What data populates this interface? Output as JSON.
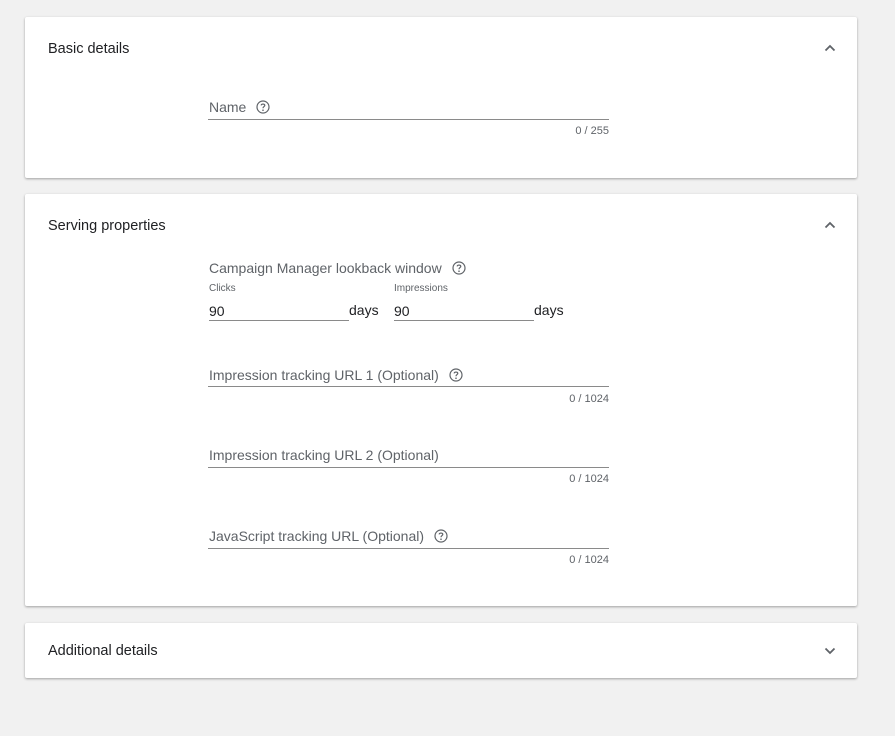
{
  "sections": {
    "basic": {
      "title": "Basic details",
      "name_field": {
        "label": "Name",
        "value": "",
        "counter": "0 / 255"
      }
    },
    "serving": {
      "title": "Serving properties",
      "lookback": {
        "title": "Campaign Manager lookback window",
        "clicks_label": "Clicks",
        "clicks_value": "90",
        "impressions_label": "Impressions",
        "impressions_value": "90",
        "unit": "days"
      },
      "impression_url_1": {
        "label": "Impression tracking URL 1 (Optional)",
        "value": "",
        "counter": "0 / 1024"
      },
      "impression_url_2": {
        "label": "Impression tracking URL 2 (Optional)",
        "value": "",
        "counter": "0 / 1024"
      },
      "javascript_url": {
        "label": "JavaScript tracking URL (Optional)",
        "value": "",
        "counter": "0 / 1024"
      }
    },
    "additional": {
      "title": "Additional details"
    }
  },
  "icons": {
    "collapse": "chevron-up-icon",
    "expand": "chevron-down-icon",
    "help": "help-circle-icon"
  },
  "colors": {
    "background": "#f1f1f1",
    "card": "#ffffff",
    "label": "#5f6368",
    "text": "#202124"
  }
}
